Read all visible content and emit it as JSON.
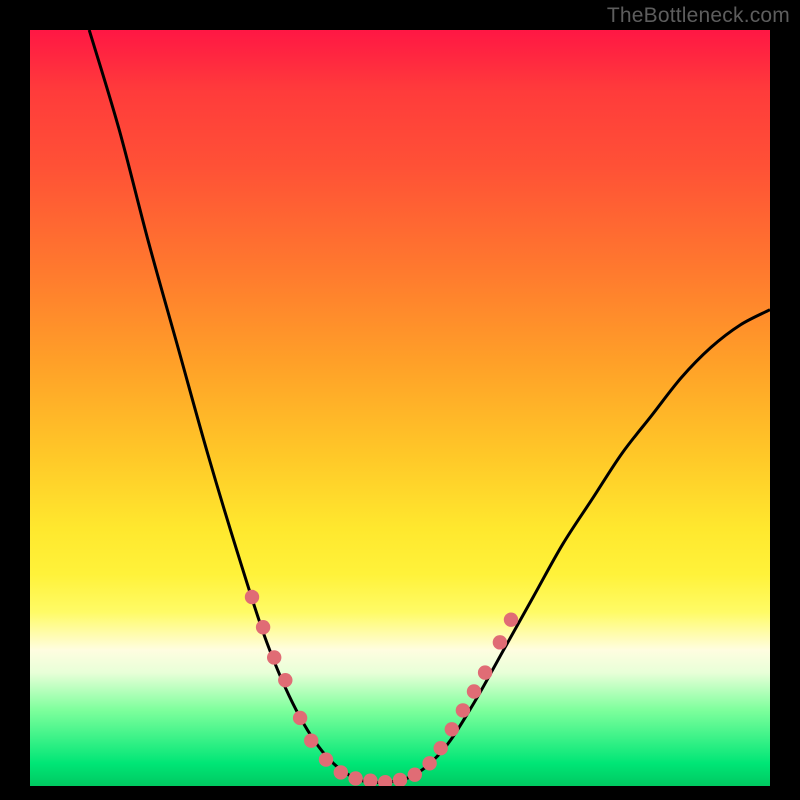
{
  "watermark": {
    "text": "TheBottleneck.com"
  },
  "colors": {
    "frame": "#000000",
    "curve_stroke": "#000000",
    "marker_fill": "#e06c75",
    "marker_stroke": "#c95a63",
    "gradient_top": "#ff1744",
    "gradient_bottom": "#00c961"
  },
  "chart_data": {
    "type": "line",
    "title": "",
    "xlabel": "",
    "ylabel": "",
    "xlim": [
      0,
      100
    ],
    "ylim": [
      0,
      100
    ],
    "curve": {
      "note": "U-shaped bottleneck curve; y≈0 at trough around x≈42–52; steep left arm from ~x=8,y=100 down; right arm rises to ~x=100,y=63",
      "points": [
        {
          "x": 8,
          "y": 100
        },
        {
          "x": 12,
          "y": 87
        },
        {
          "x": 16,
          "y": 72
        },
        {
          "x": 20,
          "y": 58
        },
        {
          "x": 24,
          "y": 44
        },
        {
          "x": 28,
          "y": 31
        },
        {
          "x": 32,
          "y": 19
        },
        {
          "x": 36,
          "y": 10
        },
        {
          "x": 40,
          "y": 4
        },
        {
          "x": 44,
          "y": 1
        },
        {
          "x": 48,
          "y": 0.5
        },
        {
          "x": 52,
          "y": 1.5
        },
        {
          "x": 56,
          "y": 5
        },
        {
          "x": 60,
          "y": 11
        },
        {
          "x": 64,
          "y": 18
        },
        {
          "x": 68,
          "y": 25
        },
        {
          "x": 72,
          "y": 32
        },
        {
          "x": 76,
          "y": 38
        },
        {
          "x": 80,
          "y": 44
        },
        {
          "x": 84,
          "y": 49
        },
        {
          "x": 88,
          "y": 54
        },
        {
          "x": 92,
          "y": 58
        },
        {
          "x": 96,
          "y": 61
        },
        {
          "x": 100,
          "y": 63
        }
      ]
    },
    "markers": {
      "note": "salmon dots highlighting the near-trough region on both arms and the flat bottom",
      "points": [
        {
          "x": 30,
          "y": 25
        },
        {
          "x": 31.5,
          "y": 21
        },
        {
          "x": 33,
          "y": 17
        },
        {
          "x": 34.5,
          "y": 14
        },
        {
          "x": 36.5,
          "y": 9
        },
        {
          "x": 38,
          "y": 6
        },
        {
          "x": 40,
          "y": 3.5
        },
        {
          "x": 42,
          "y": 1.8
        },
        {
          "x": 44,
          "y": 1.0
        },
        {
          "x": 46,
          "y": 0.7
        },
        {
          "x": 48,
          "y": 0.5
        },
        {
          "x": 50,
          "y": 0.8
        },
        {
          "x": 52,
          "y": 1.5
        },
        {
          "x": 54,
          "y": 3
        },
        {
          "x": 55.5,
          "y": 5
        },
        {
          "x": 57,
          "y": 7.5
        },
        {
          "x": 58.5,
          "y": 10
        },
        {
          "x": 60,
          "y": 12.5
        },
        {
          "x": 61.5,
          "y": 15
        },
        {
          "x": 63.5,
          "y": 19
        },
        {
          "x": 65,
          "y": 22
        }
      ]
    }
  }
}
